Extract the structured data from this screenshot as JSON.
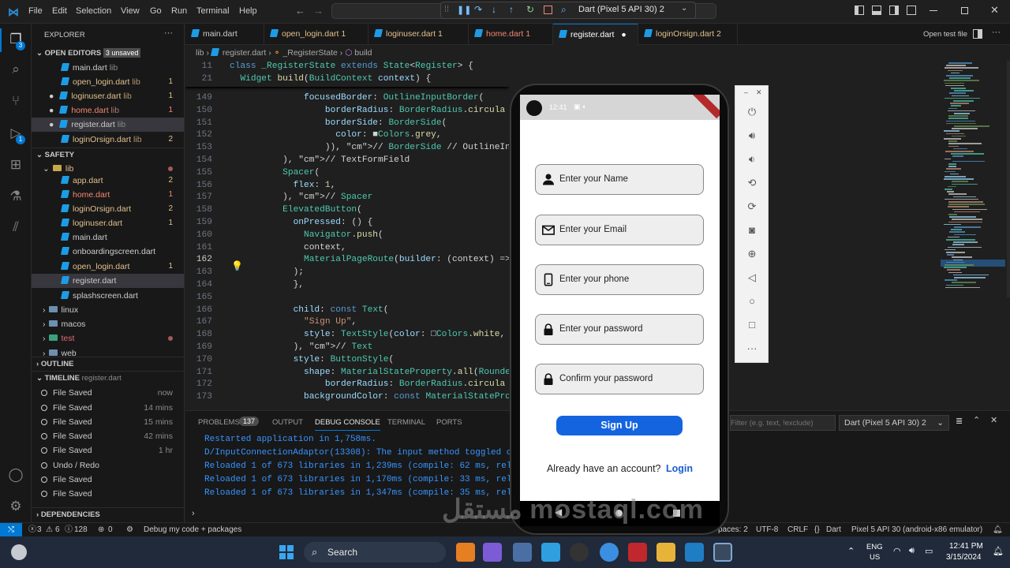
{
  "menu": [
    "File",
    "Edit",
    "Selection",
    "View",
    "Go",
    "Run",
    "Terminal",
    "Help"
  ],
  "debug_device": "Dart (Pixel 5 API 30) 2",
  "explorer": {
    "title": "EXPLORER",
    "open_editors": "OPEN EDITORS",
    "unsaved": "3 unsaved",
    "open_files": [
      {
        "name": "main.dart",
        "suffix": "lib",
        "count": ""
      },
      {
        "name": "open_login.dart",
        "suffix": "lib",
        "count": "1"
      },
      {
        "name": "loginuser.dart",
        "suffix": "lib",
        "count": "1"
      },
      {
        "name": "home.dart",
        "suffix": "lib",
        "count": "1"
      },
      {
        "name": "register.dart",
        "suffix": "lib",
        "count": ""
      },
      {
        "name": "loginOrsign.dart",
        "suffix": "lib",
        "count": "2"
      }
    ],
    "project": "SAFETY",
    "lib_folder": "lib",
    "lib_files": [
      {
        "name": "app.dart",
        "count": "2"
      },
      {
        "name": "home.dart",
        "count": "1"
      },
      {
        "name": "loginOrsign.dart",
        "count": "2"
      },
      {
        "name": "loginuser.dart",
        "count": "1"
      },
      {
        "name": "main.dart",
        "count": ""
      },
      {
        "name": "onboardingscreen.dart",
        "count": ""
      },
      {
        "name": "open_login.dart",
        "count": "1"
      },
      {
        "name": "register.dart",
        "count": ""
      },
      {
        "name": "splashscreen.dart",
        "count": ""
      }
    ],
    "folders": [
      "linux",
      "macos",
      "test",
      "web"
    ],
    "outline": "OUTLINE",
    "timeline": "TIMELINE",
    "timeline_file": "register.dart",
    "timeline_items": [
      {
        "label": "File Saved",
        "time": "now"
      },
      {
        "label": "File Saved",
        "time": "14 mins"
      },
      {
        "label": "File Saved",
        "time": "15 mins"
      },
      {
        "label": "File Saved",
        "time": "42 mins"
      },
      {
        "label": "File Saved",
        "time": "1 hr"
      },
      {
        "label": "Undo / Redo",
        "time": ""
      },
      {
        "label": "File Saved",
        "time": ""
      },
      {
        "label": "File Saved",
        "time": ""
      }
    ],
    "dependencies": "DEPENDENCIES"
  },
  "tabs": [
    {
      "name": "main.dart",
      "badge": ""
    },
    {
      "name": "open_login.dart",
      "badge": "1"
    },
    {
      "name": "loginuser.dart",
      "badge": "1"
    },
    {
      "name": "home.dart",
      "badge": "1"
    },
    {
      "name": "register.dart",
      "badge": "●"
    },
    {
      "name": "loginOrsign.dart",
      "badge": "2"
    }
  ],
  "open_test_file": "Open test file",
  "breadcrumb": {
    "a": "lib",
    "b": "register.dart",
    "c": "_RegisterState",
    "d": "build"
  },
  "code_sticky": [
    {
      "n": "11",
      "t": "class _RegisterState extends State<Register> {"
    },
    {
      "n": "21",
      "t": "  Widget build(BuildContext context) {"
    }
  ],
  "code_lines": [
    {
      "n": "149",
      "t": "              focusedBorder: OutlineInputBorder("
    },
    {
      "n": "150",
      "t": "                  borderRadius: BorderRadius.circula"
    },
    {
      "n": "151",
      "t": "                  borderSide: BorderSide("
    },
    {
      "n": "152",
      "t": "                    color: ■Colors.grey,"
    },
    {
      "n": "153",
      "t": "                  )), // BorderSide // OutlineInpu"
    },
    {
      "n": "154",
      "t": "          ), // TextFormField"
    },
    {
      "n": "155",
      "t": "          Spacer("
    },
    {
      "n": "156",
      "t": "            flex: 1,"
    },
    {
      "n": "157",
      "t": "          ), // Spacer"
    },
    {
      "n": "158",
      "t": "          ElevatedButton("
    },
    {
      "n": "159",
      "t": "            onPressed: () {"
    },
    {
      "n": "160",
      "t": "              Navigator.push("
    },
    {
      "n": "161",
      "t": "              context,"
    },
    {
      "n": "162",
      "t": "              MaterialPageRoute(builder: (context) =>"
    },
    {
      "n": "163",
      "t": "            );"
    },
    {
      "n": "164",
      "t": "            },"
    },
    {
      "n": "165",
      "t": ""
    },
    {
      "n": "166",
      "t": "            child: const Text("
    },
    {
      "n": "167",
      "t": "              \"Sign Up\","
    },
    {
      "n": "168",
      "t": "              style: TextStyle(color: □Colors.white,"
    },
    {
      "n": "169",
      "t": "            ), // Text"
    },
    {
      "n": "170",
      "t": "            style: ButtonStyle("
    },
    {
      "n": "171",
      "t": "              shape: MaterialStateProperty.all(Rounded"
    },
    {
      "n": "172",
      "t": "                  borderRadius: BorderRadius.circula"
    },
    {
      "n": "173",
      "t": "              backgroundColor: const MaterialStatePro"
    }
  ],
  "panel": {
    "tabs": [
      "PROBLEMS",
      "OUTPUT",
      "DEBUG CONSOLE",
      "TERMINAL",
      "PORTS"
    ],
    "problems_count": "137",
    "filter_placeholder": "Filter (e.g. text, !exclude)",
    "session": "Dart (Pixel 5 API 30) 2",
    "console": [
      "Restarted application in 1,758ms.",
      "D/InputConnectionAdaptor(13308): The input method toggled cur",
      "Reloaded 1 of 673 libraries in 1,239ms (compile: 62 ms, reloa",
      "Reloaded 1 of 673 libraries in 1,170ms (compile: 33 ms, reloa",
      "Reloaded 1 of 673 libraries in 1,347ms (compile: 35 ms, reloa"
    ]
  },
  "statusbar": {
    "errors": "3",
    "warnings": "6",
    "info": "128",
    "ports": "0",
    "debug": "Debug my code + packages",
    "spaces": "paces: 2",
    "encoding": "UTF-8",
    "eol": "CRLF",
    "lang": "Dart",
    "device": "Pixel 5 API 30 (android-x86 emulator)"
  },
  "phone": {
    "time": "12:41",
    "fields": [
      "Enter your Name",
      "Enter your Email",
      "Enter your phone",
      "Enter your password",
      "Confirm your password"
    ],
    "signup": "Sign Up",
    "account_q": "Already have an account?",
    "login": "Login"
  },
  "taskbar": {
    "search": "Search",
    "lang1": "ENG",
    "lang2": "US",
    "time": "12:41 PM",
    "date": "3/15/2024"
  },
  "watermark": "مستقل mostaql.com",
  "colors": {
    "accent": "#0078d4",
    "modified": "#e2c08d",
    "dart": "#1d9ce6",
    "button": "#1464e0",
    "link": "#1a5fd0"
  }
}
